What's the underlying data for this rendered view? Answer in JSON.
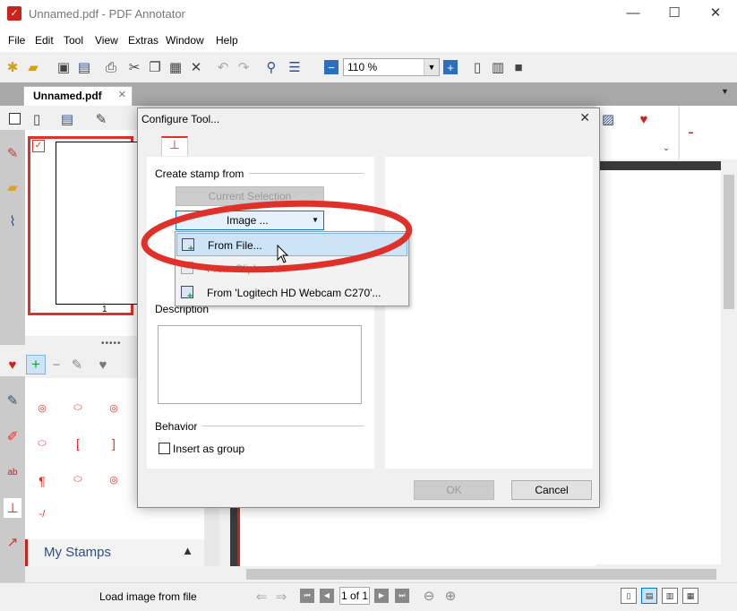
{
  "window": {
    "title": "Unnamed.pdf - PDF Annotator",
    "minimize": "—",
    "maximize": "☐",
    "close": "✕"
  },
  "menu": [
    "File",
    "Edit",
    "Tool",
    "View",
    "Extras",
    "Window",
    "Help"
  ],
  "toolbar": {
    "zoom_value": "110 %"
  },
  "document_tab": {
    "label": "Unnamed.pdf",
    "close": "✕"
  },
  "thumbnail": {
    "page_number": "1"
  },
  "stamps_panel": {
    "section_label": "My Stamps"
  },
  "dialog": {
    "title": "Configure Tool...",
    "close": "✕",
    "create_stamp_from_label": "Create stamp from",
    "current_selection_button": "Current Selection",
    "image_button": "Image ...",
    "description_label": "Description",
    "behavior_label": "Behavior",
    "insert_as_group_label": "Insert as group",
    "ok_button": "OK",
    "cancel_button": "Cancel"
  },
  "image_menu": {
    "items": [
      "From File...",
      "From Clipboard",
      "From 'Logitech HD Webcam C270'..."
    ]
  },
  "statusbar": {
    "status_text": "Load image from file",
    "page_box": "1 of 1"
  },
  "colors": {
    "accent_red": "#e0302a",
    "highlight_blue": "#cde4f7",
    "menu_blue_text": "#2c4f8c"
  }
}
